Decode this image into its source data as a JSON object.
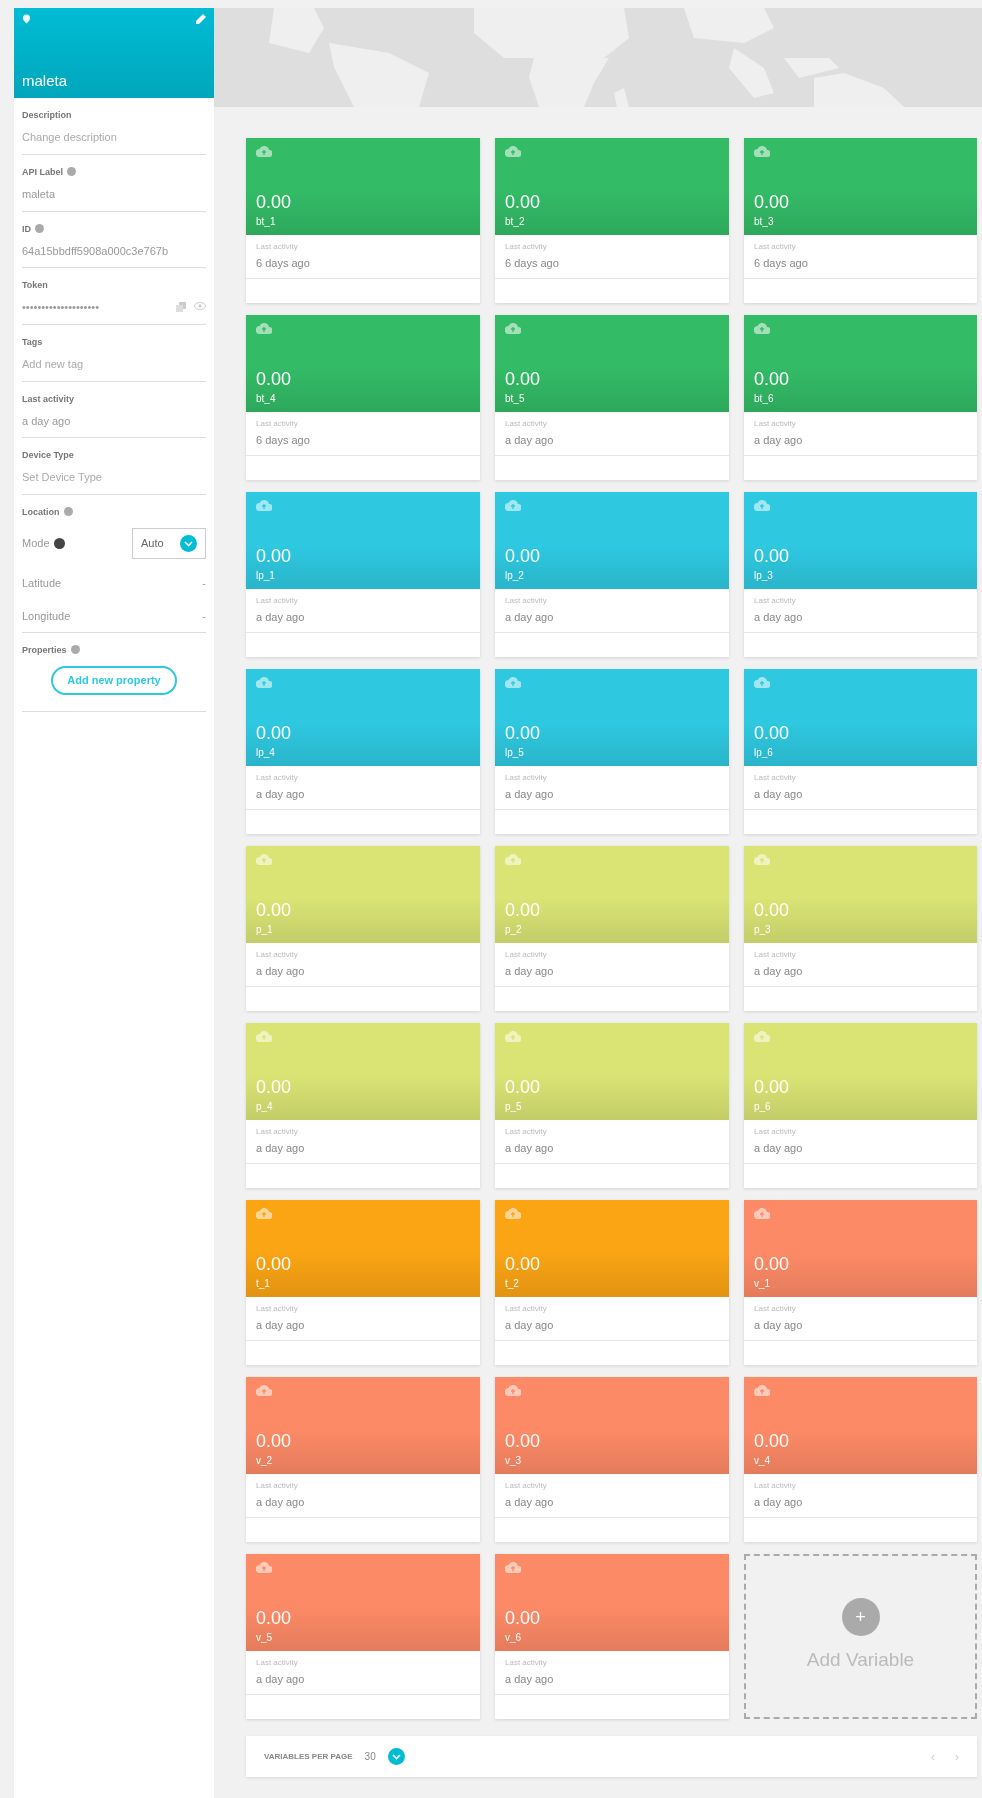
{
  "device": {
    "name": "maleta"
  },
  "sidebar": {
    "fields": [
      {
        "kind": "input",
        "label": "Description",
        "info": false,
        "placeholder": "Change description"
      },
      {
        "kind": "text",
        "label": "API Label",
        "info": true,
        "value": "maleta"
      },
      {
        "kind": "text",
        "label": "ID",
        "info": true,
        "value": "64a15bbdff5908a000c3e767b"
      },
      {
        "kind": "token",
        "label": "Token",
        "info": false,
        "value": "••••••••••••••••••••"
      },
      {
        "kind": "input",
        "label": "Tags",
        "info": false,
        "placeholder": "Add new tag"
      },
      {
        "kind": "text",
        "label": "Last activity",
        "info": false,
        "value": "a day ago"
      },
      {
        "kind": "input",
        "label": "Device Type",
        "info": false,
        "placeholder": "Set Device Type"
      }
    ],
    "location": {
      "label": "Location",
      "mode_label": "Mode",
      "mode": "Auto",
      "coords": [
        {
          "label": "Latitude",
          "value": "-"
        },
        {
          "label": "Longitude",
          "value": "-"
        }
      ]
    },
    "properties": {
      "label": "Properties",
      "button": "Add new property"
    }
  },
  "variables": [
    {
      "name": "bt_1",
      "value": "0.00",
      "activity_label": "Last activity",
      "activity": "6 days ago",
      "color": "#33bb66"
    },
    {
      "name": "bt_2",
      "value": "0.00",
      "activity_label": "Last activity",
      "activity": "6 days ago",
      "color": "#33bb66"
    },
    {
      "name": "bt_3",
      "value": "0.00",
      "activity_label": "Last activity",
      "activity": "6 days ago",
      "color": "#33bb66"
    },
    {
      "name": "bt_4",
      "value": "0.00",
      "activity_label": "Last activity",
      "activity": "6 days ago",
      "color": "#33bb66"
    },
    {
      "name": "bt_5",
      "value": "0.00",
      "activity_label": "Last activity",
      "activity": "a day ago",
      "color": "#33bb66"
    },
    {
      "name": "bt_6",
      "value": "0.00",
      "activity_label": "Last activity",
      "activity": "a day ago",
      "color": "#33bb66"
    },
    {
      "name": "lp_1",
      "value": "0.00",
      "activity_label": "Last activity",
      "activity": "a day ago",
      "color": "#2ec9e1"
    },
    {
      "name": "lp_2",
      "value": "0.00",
      "activity_label": "Last activity",
      "activity": "a day ago",
      "color": "#2ec9e1"
    },
    {
      "name": "lp_3",
      "value": "0.00",
      "activity_label": "Last activity",
      "activity": "a day ago",
      "color": "#2ec9e1"
    },
    {
      "name": "lp_4",
      "value": "0.00",
      "activity_label": "Last activity",
      "activity": "a day ago",
      "color": "#2ec9e1"
    },
    {
      "name": "lp_5",
      "value": "0.00",
      "activity_label": "Last activity",
      "activity": "a day ago",
      "color": "#2ec9e1"
    },
    {
      "name": "lp_6",
      "value": "0.00",
      "activity_label": "Last activity",
      "activity": "a day ago",
      "color": "#2ec9e1"
    },
    {
      "name": "p_1",
      "value": "0.00",
      "activity_label": "Last activity",
      "activity": "a day ago",
      "color": "#d9e474"
    },
    {
      "name": "p_2",
      "value": "0.00",
      "activity_label": "Last activity",
      "activity": "a day ago",
      "color": "#d9e474"
    },
    {
      "name": "p_3",
      "value": "0.00",
      "activity_label": "Last activity",
      "activity": "a day ago",
      "color": "#d9e474"
    },
    {
      "name": "p_4",
      "value": "0.00",
      "activity_label": "Last activity",
      "activity": "a day ago",
      "color": "#d9e474"
    },
    {
      "name": "p_5",
      "value": "0.00",
      "activity_label": "Last activity",
      "activity": "a day ago",
      "color": "#d9e474"
    },
    {
      "name": "p_6",
      "value": "0.00",
      "activity_label": "Last activity",
      "activity": "a day ago",
      "color": "#d9e474"
    },
    {
      "name": "t_1",
      "value": "0.00",
      "activity_label": "Last activity",
      "activity": "a day ago",
      "color": "#fba414"
    },
    {
      "name": "t_2",
      "value": "0.00",
      "activity_label": "Last activity",
      "activity": "a day ago",
      "color": "#fba414"
    },
    {
      "name": "v_1",
      "value": "0.00",
      "activity_label": "Last activity",
      "activity": "a day ago",
      "color": "#fd8a66"
    },
    {
      "name": "v_2",
      "value": "0.00",
      "activity_label": "Last activity",
      "activity": "a day ago",
      "color": "#fd8a66"
    },
    {
      "name": "v_3",
      "value": "0.00",
      "activity_label": "Last activity",
      "activity": "a day ago",
      "color": "#fd8a66"
    },
    {
      "name": "v_4",
      "value": "0.00",
      "activity_label": "Last activity",
      "activity": "a day ago",
      "color": "#fd8a66"
    },
    {
      "name": "v_5",
      "value": "0.00",
      "activity_label": "Last activity",
      "activity": "a day ago",
      "color": "#fd8a66"
    },
    {
      "name": "v_6",
      "value": "0.00",
      "activity_label": "Last activity",
      "activity": "a day ago",
      "color": "#fd8a66"
    }
  ],
  "add_variable": {
    "label": "Add Variable",
    "icon": "+"
  },
  "pager": {
    "label": "VARIABLES PER PAGE",
    "value": "30",
    "prev": "‹",
    "next": "›"
  }
}
